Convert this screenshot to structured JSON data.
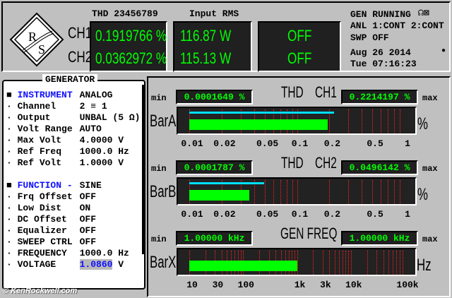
{
  "header": {
    "thd_label": "THD 23456789",
    "rms_label": "Input RMS",
    "ch1_label": "CH1",
    "ch2_label": "CH2",
    "ch1_thd": "0.1919766 %",
    "ch2_thd": "0.0362972 %",
    "ch1_rms": "116.87  W",
    "ch2_rms": "115.13  W",
    "ch1_aux": "OFF",
    "ch2_aux": "OFF",
    "status": "GEN RUNNING",
    "anl": "ANL 1:CONT 2:CONT",
    "swp": "SWP OFF",
    "date": "Aug 26 2014",
    "time": "Tue 07:16:23",
    "status_icons": [
      "speaker-icon",
      "mute-icon"
    ]
  },
  "generator": {
    "title": "GENERATOR",
    "rows": [
      {
        "label": "INSTRUMENT",
        "value": "ANALOG",
        "section": true
      },
      {
        "label": "Channel",
        "value": "2 ≡ 1"
      },
      {
        "label": "Output",
        "value": "UNBAL (5 Ω)"
      },
      {
        "label": "Volt Range",
        "value": "AUTO"
      },
      {
        "label": "Max Volt",
        "value": "4.0000 V"
      },
      {
        "label": "Ref Freq",
        "value": "1000.0 Hz"
      },
      {
        "label": "Ref Volt",
        "value": "1.0000 V"
      },
      {
        "label": "FUNCTION -",
        "value": "SINE",
        "section": true
      },
      {
        "label": "Frq Offset",
        "value": "OFF"
      },
      {
        "label": "Low Dist",
        "value": "ON"
      },
      {
        "label": "DC Offset",
        "value": "OFF"
      },
      {
        "label": "Equalizer",
        "value": "OFF"
      },
      {
        "label": "SWEEP CTRL",
        "value": "OFF"
      },
      {
        "label": "FREQUENCY",
        "value": "1000.0 Hz"
      },
      {
        "label": "VOLTAGE",
        "value": "1.0860",
        "unit": " V",
        "editing": true
      }
    ]
  },
  "watermark": "© KenRockwell.com",
  "bars": [
    {
      "name": "BarA",
      "title1": "THD",
      "title2": "CH1",
      "min_label": "min",
      "max_label": "max",
      "min": "0.0001649 %",
      "max": "0.2214197 %",
      "unit": "%",
      "scale": "log",
      "range": [
        0.01,
        1
      ],
      "value": 0.1919766,
      "max_value": 0.2214197,
      "ticks": [
        [
          "0.01",
          0.01
        ],
        [
          "0.02",
          0.02
        ],
        [
          "0.05",
          0.05
        ],
        [
          "0.1",
          0.1
        ],
        [
          "0.2",
          0.2
        ],
        [
          "0.5",
          0.5
        ],
        [
          "1",
          1
        ]
      ]
    },
    {
      "name": "BarB",
      "title1": "THD",
      "title2": "CH2",
      "min_label": "min",
      "max_label": "max",
      "min": "0.0001787 %",
      "max": "0.0496142 %",
      "unit": "%",
      "scale": "log",
      "range": [
        0.01,
        1
      ],
      "value": 0.0362972,
      "max_value": 0.0496142,
      "ticks": [
        [
          "0.01",
          0.01
        ],
        [
          "0.02",
          0.02
        ],
        [
          "0.05",
          0.05
        ],
        [
          "0.1",
          0.1
        ],
        [
          "0.2",
          0.2
        ],
        [
          "0.5",
          0.5
        ],
        [
          "1",
          1
        ]
      ]
    },
    {
      "name": "BarX",
      "title1": "GEN FREQ",
      "title2": "",
      "min_label": "min",
      "max_label": "max",
      "min": "1.00000 kHz",
      "max": "1.00000 kHz",
      "unit": "Hz",
      "scale": "log",
      "range": [
        10,
        100000
      ],
      "value": 1000,
      "max_value": null,
      "ticks": [
        [
          "10",
          10
        ],
        [
          "30",
          30
        ],
        [
          "100",
          100
        ],
        [
          "1k",
          1000
        ],
        [
          "3k",
          3000
        ],
        [
          "10k",
          10000
        ],
        [
          "100k",
          100000
        ]
      ]
    }
  ],
  "colors": {
    "lcd_text": "#00ff00",
    "bar_fill": "#00ff00",
    "bar_max": "#00e0ff",
    "grid": "#ff2020",
    "section": "#1010ff"
  }
}
